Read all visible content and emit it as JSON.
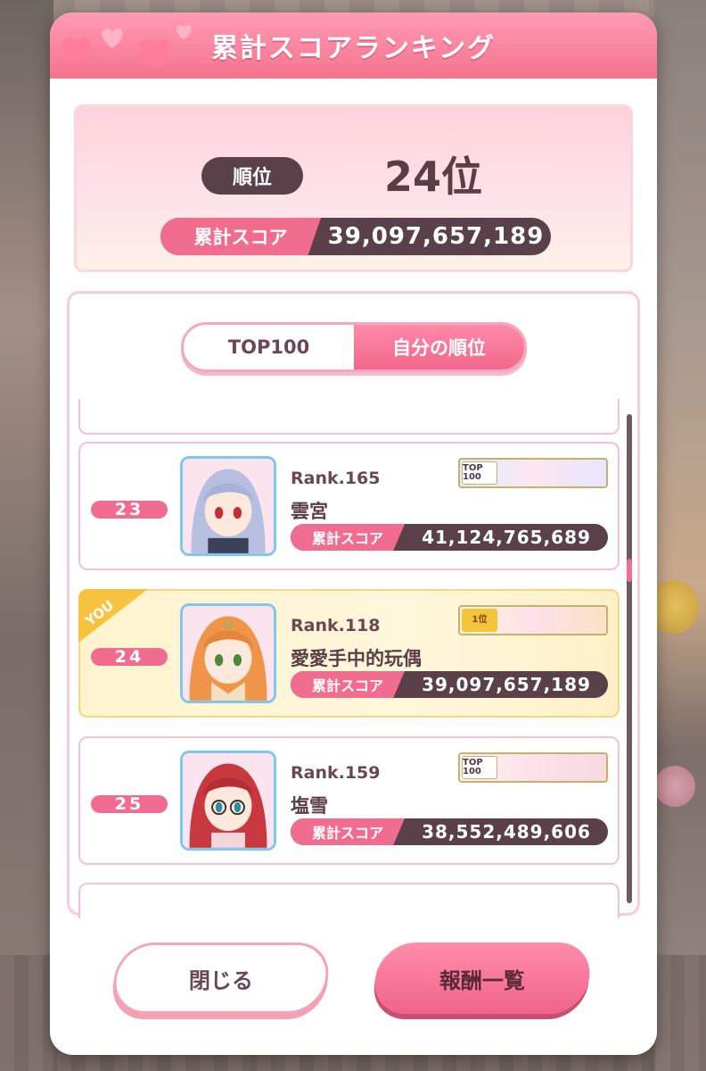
{
  "dialog": {
    "title": "累計スコアランキング"
  },
  "summary": {
    "rank_label": "順位",
    "rank_value": "24位",
    "score_label": "累計スコア",
    "score_value": "39,097,657,189"
  },
  "tabs": [
    {
      "label": "TOP100",
      "active": false
    },
    {
      "label": "自分の順位",
      "active": true
    }
  ],
  "rows": [
    {
      "position": "23",
      "rank": "Rank.165",
      "name": "雲宮",
      "score_label": "累計スコア",
      "score": "41,124,765,689",
      "badge_text": "TOP 100",
      "hair_color": "#b7bfe0",
      "eye_color": "#c0303a",
      "is_me": false
    },
    {
      "position": "24",
      "rank": "Rank.118",
      "name": "愛愛手中的玩偶",
      "score_label": "累計スコア",
      "score": "39,097,657,189",
      "badge_text": "1位",
      "hair_color": "#f0944a",
      "eye_color": "#4a8a3a",
      "is_me": true,
      "you_label": "YOU"
    },
    {
      "position": "25",
      "rank": "Rank.159",
      "name": "塩雪",
      "score_label": "累計スコア",
      "score": "38,552,489,606",
      "badge_text": "TOP 100",
      "hair_color": "#c8383f",
      "eye_color": "#2a8fa0",
      "is_me": false
    }
  ],
  "buttons": {
    "close": "閉じる",
    "rewards": "報酬一覧"
  },
  "colors": {
    "accent_pink": "#f06d90",
    "dark_pill": "#5a4048",
    "highlight_row": "#fff3cf"
  }
}
